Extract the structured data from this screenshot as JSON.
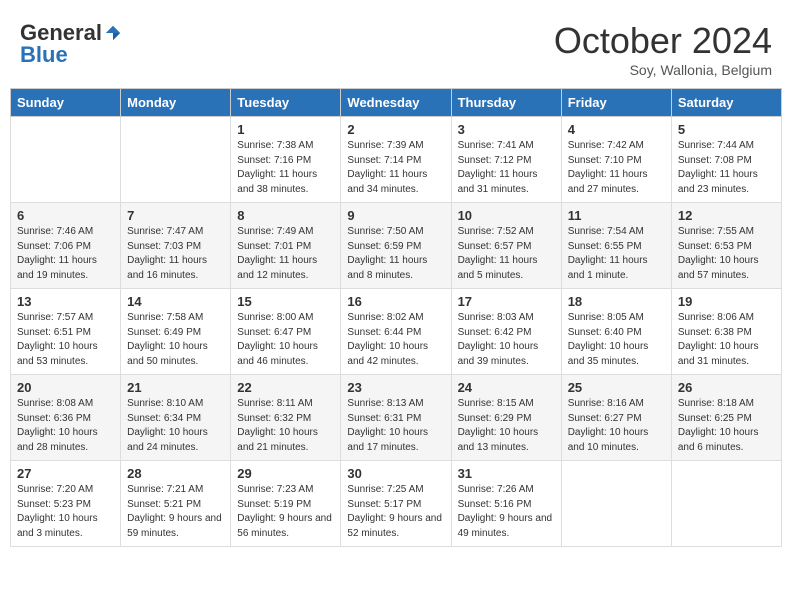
{
  "header": {
    "logo_general": "General",
    "logo_blue": "Blue",
    "month_title": "October 2024",
    "subtitle": "Soy, Wallonia, Belgium"
  },
  "weekdays": [
    "Sunday",
    "Monday",
    "Tuesday",
    "Wednesday",
    "Thursday",
    "Friday",
    "Saturday"
  ],
  "weeks": [
    [
      {
        "day": "",
        "info": ""
      },
      {
        "day": "",
        "info": ""
      },
      {
        "day": "1",
        "info": "Sunrise: 7:38 AM\nSunset: 7:16 PM\nDaylight: 11 hours and 38 minutes."
      },
      {
        "day": "2",
        "info": "Sunrise: 7:39 AM\nSunset: 7:14 PM\nDaylight: 11 hours and 34 minutes."
      },
      {
        "day": "3",
        "info": "Sunrise: 7:41 AM\nSunset: 7:12 PM\nDaylight: 11 hours and 31 minutes."
      },
      {
        "day": "4",
        "info": "Sunrise: 7:42 AM\nSunset: 7:10 PM\nDaylight: 11 hours and 27 minutes."
      },
      {
        "day": "5",
        "info": "Sunrise: 7:44 AM\nSunset: 7:08 PM\nDaylight: 11 hours and 23 minutes."
      }
    ],
    [
      {
        "day": "6",
        "info": "Sunrise: 7:46 AM\nSunset: 7:06 PM\nDaylight: 11 hours and 19 minutes."
      },
      {
        "day": "7",
        "info": "Sunrise: 7:47 AM\nSunset: 7:03 PM\nDaylight: 11 hours and 16 minutes."
      },
      {
        "day": "8",
        "info": "Sunrise: 7:49 AM\nSunset: 7:01 PM\nDaylight: 11 hours and 12 minutes."
      },
      {
        "day": "9",
        "info": "Sunrise: 7:50 AM\nSunset: 6:59 PM\nDaylight: 11 hours and 8 minutes."
      },
      {
        "day": "10",
        "info": "Sunrise: 7:52 AM\nSunset: 6:57 PM\nDaylight: 11 hours and 5 minutes."
      },
      {
        "day": "11",
        "info": "Sunrise: 7:54 AM\nSunset: 6:55 PM\nDaylight: 11 hours and 1 minute."
      },
      {
        "day": "12",
        "info": "Sunrise: 7:55 AM\nSunset: 6:53 PM\nDaylight: 10 hours and 57 minutes."
      }
    ],
    [
      {
        "day": "13",
        "info": "Sunrise: 7:57 AM\nSunset: 6:51 PM\nDaylight: 10 hours and 53 minutes."
      },
      {
        "day": "14",
        "info": "Sunrise: 7:58 AM\nSunset: 6:49 PM\nDaylight: 10 hours and 50 minutes."
      },
      {
        "day": "15",
        "info": "Sunrise: 8:00 AM\nSunset: 6:47 PM\nDaylight: 10 hours and 46 minutes."
      },
      {
        "day": "16",
        "info": "Sunrise: 8:02 AM\nSunset: 6:44 PM\nDaylight: 10 hours and 42 minutes."
      },
      {
        "day": "17",
        "info": "Sunrise: 8:03 AM\nSunset: 6:42 PM\nDaylight: 10 hours and 39 minutes."
      },
      {
        "day": "18",
        "info": "Sunrise: 8:05 AM\nSunset: 6:40 PM\nDaylight: 10 hours and 35 minutes."
      },
      {
        "day": "19",
        "info": "Sunrise: 8:06 AM\nSunset: 6:38 PM\nDaylight: 10 hours and 31 minutes."
      }
    ],
    [
      {
        "day": "20",
        "info": "Sunrise: 8:08 AM\nSunset: 6:36 PM\nDaylight: 10 hours and 28 minutes."
      },
      {
        "day": "21",
        "info": "Sunrise: 8:10 AM\nSunset: 6:34 PM\nDaylight: 10 hours and 24 minutes."
      },
      {
        "day": "22",
        "info": "Sunrise: 8:11 AM\nSunset: 6:32 PM\nDaylight: 10 hours and 21 minutes."
      },
      {
        "day": "23",
        "info": "Sunrise: 8:13 AM\nSunset: 6:31 PM\nDaylight: 10 hours and 17 minutes."
      },
      {
        "day": "24",
        "info": "Sunrise: 8:15 AM\nSunset: 6:29 PM\nDaylight: 10 hours and 13 minutes."
      },
      {
        "day": "25",
        "info": "Sunrise: 8:16 AM\nSunset: 6:27 PM\nDaylight: 10 hours and 10 minutes."
      },
      {
        "day": "26",
        "info": "Sunrise: 8:18 AM\nSunset: 6:25 PM\nDaylight: 10 hours and 6 minutes."
      }
    ],
    [
      {
        "day": "27",
        "info": "Sunrise: 7:20 AM\nSunset: 5:23 PM\nDaylight: 10 hours and 3 minutes."
      },
      {
        "day": "28",
        "info": "Sunrise: 7:21 AM\nSunset: 5:21 PM\nDaylight: 9 hours and 59 minutes."
      },
      {
        "day": "29",
        "info": "Sunrise: 7:23 AM\nSunset: 5:19 PM\nDaylight: 9 hours and 56 minutes."
      },
      {
        "day": "30",
        "info": "Sunrise: 7:25 AM\nSunset: 5:17 PM\nDaylight: 9 hours and 52 minutes."
      },
      {
        "day": "31",
        "info": "Sunrise: 7:26 AM\nSunset: 5:16 PM\nDaylight: 9 hours and 49 minutes."
      },
      {
        "day": "",
        "info": ""
      },
      {
        "day": "",
        "info": ""
      }
    ]
  ]
}
